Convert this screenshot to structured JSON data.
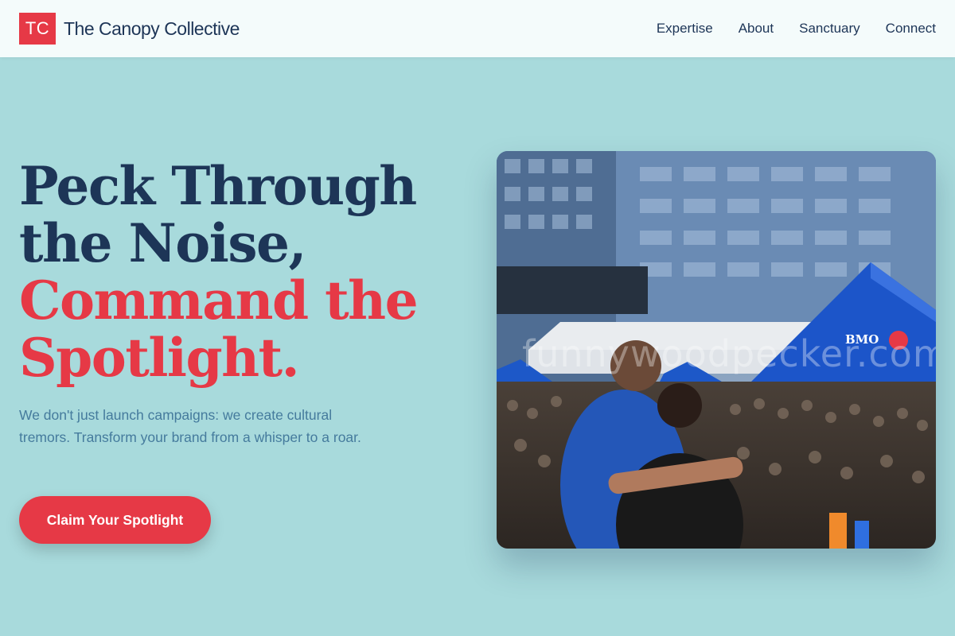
{
  "header": {
    "logo_text": "TC",
    "brand_name": "The Canopy Collective",
    "nav": [
      "Expertise",
      "About",
      "Sanctuary",
      "Connect"
    ]
  },
  "hero": {
    "headline_line1": "Peck Through",
    "headline_line2": "the Noise,",
    "headline_line3": "Command the",
    "headline_line4": "Spotlight.",
    "subtext": "We don't just launch campaigns: we create cultural tremors. Transform your brand from a whisper to a roar.",
    "cta_label": "Claim Your Spotlight"
  },
  "photo": {
    "tent_brand": "BMO",
    "watermark": "funnywoodpecker.com"
  },
  "colors": {
    "background": "#a8dadc",
    "header": "#f4fbfb",
    "navy": "#1d3557",
    "accent": "#e63946",
    "body_text": "#457b9d"
  }
}
